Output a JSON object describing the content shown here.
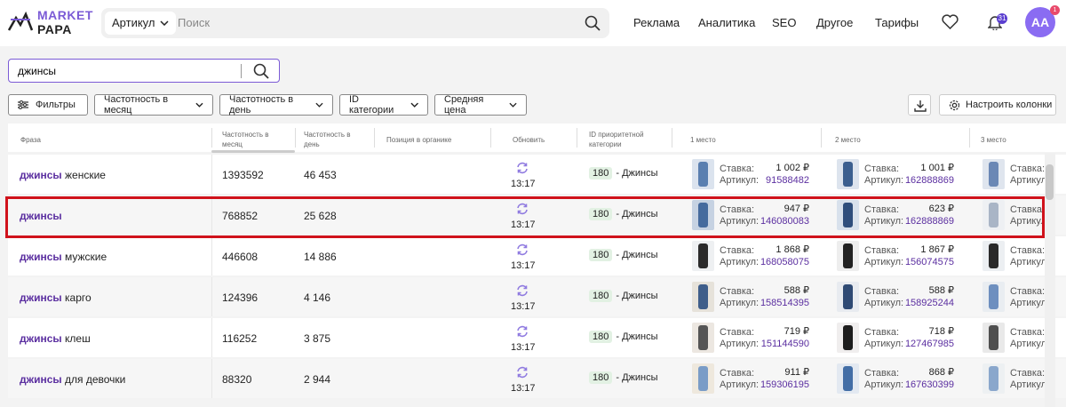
{
  "brand": {
    "line1": "MARKET",
    "line2": "PAPA"
  },
  "header": {
    "search_type": "Артикул",
    "search_placeholder": "Поиск",
    "nav": [
      "Реклама",
      "Аналитика",
      "SEO",
      "Другое",
      "Тарифы"
    ],
    "notifications_count": "31",
    "avatar_initials": "AA",
    "avatar_badge": "1"
  },
  "query": {
    "value": "джинсы"
  },
  "filters": {
    "filters_label": "Фильтры",
    "dropdowns": [
      "Частотность в месяц",
      "Частотность в день",
      "ID категории",
      "Средняя цена"
    ],
    "columns_label": "Настроить колонки"
  },
  "table": {
    "headers": {
      "phrase": "Фраза",
      "freq_month": "Частотность в месяц",
      "freq_day": "Частотность в день",
      "position": "Позиция в органике",
      "update": "Обновить",
      "category": "ID приоритетной категории",
      "place1": "1 место",
      "place2": "2 место",
      "place3": "3 место"
    },
    "labels": {
      "bid": "Ставка:",
      "article": "Артикул:"
    },
    "rows": [
      {
        "bold": "джинсы",
        "rest": " женские",
        "month": "1393592",
        "day": "46 453",
        "time": "13:17",
        "cat_id": "180",
        "cat_name": "- Джинсы",
        "p1": {
          "price": "1 002 ₽",
          "art": "91588482"
        },
        "p2": {
          "price": "1 001 ₽",
          "art": "162888869"
        }
      },
      {
        "bold": "джинсы",
        "rest": "",
        "month": "768852",
        "day": "25 628",
        "time": "13:17",
        "cat_id": "180",
        "cat_name": "- Джинсы",
        "p1": {
          "price": "947 ₽",
          "art": "146080083"
        },
        "p2": {
          "price": "623 ₽",
          "art": "162888869"
        }
      },
      {
        "bold": "джинсы",
        "rest": " мужские",
        "month": "446608",
        "day": "14 886",
        "time": "13:17",
        "cat_id": "180",
        "cat_name": "- Джинсы",
        "p1": {
          "price": "1 868 ₽",
          "art": "168058075"
        },
        "p2": {
          "price": "1 867 ₽",
          "art": "156074575"
        }
      },
      {
        "bold": "джинсы",
        "rest": " карго",
        "month": "124396",
        "day": "4 146",
        "time": "13:17",
        "cat_id": "180",
        "cat_name": "- Джинсы",
        "p1": {
          "price": "588 ₽",
          "art": "158514395"
        },
        "p2": {
          "price": "588 ₽",
          "art": "158925244"
        }
      },
      {
        "bold": "джинсы",
        "rest": " клеш",
        "month": "116252",
        "day": "3 875",
        "time": "13:17",
        "cat_id": "180",
        "cat_name": "- Джинсы",
        "p1": {
          "price": "719 ₽",
          "art": "151144590"
        },
        "p2": {
          "price": "718 ₽",
          "art": "127467985"
        }
      },
      {
        "bold": "джинсы",
        "rest": " для девочки",
        "month": "88320",
        "day": "2 944",
        "time": "13:17",
        "cat_id": "180",
        "cat_name": "- Джинсы",
        "p1": {
          "price": "911 ₽",
          "art": "159306195"
        },
        "p2": {
          "price": "868 ₽",
          "art": "167630399"
        }
      }
    ]
  },
  "colors": {
    "accent": "#7b5bd6",
    "article": "#5b2fa0",
    "highlight": "#d0121b"
  }
}
